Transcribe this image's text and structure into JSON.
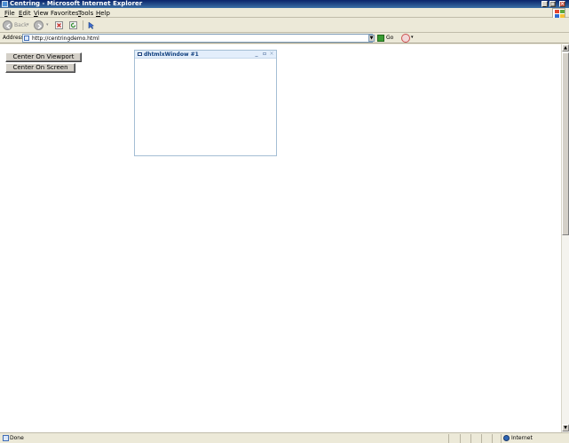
{
  "window": {
    "title": "Centring - Microsoft Internet Explorer"
  },
  "menu": {
    "items": [
      {
        "u": "F",
        "rest": "ile"
      },
      {
        "u": "E",
        "rest": "dit"
      },
      {
        "u": "V",
        "rest": "iew"
      },
      {
        "u": "",
        "rest": "Favorites",
        "label": "Favorites"
      },
      {
        "u": "T",
        "rest": "ools"
      },
      {
        "u": "H",
        "rest": "elp"
      }
    ]
  },
  "toolbar": {
    "back_label": "Back"
  },
  "address": {
    "label": "Address",
    "url": "http://centringdemo.html",
    "go_label": "Go"
  },
  "page": {
    "btn_viewport": "Center On Viewport",
    "btn_screen": "Center On Screen"
  },
  "dhx_window": {
    "title": "dhtmlxWindow #1"
  },
  "status": {
    "text": "Done",
    "zone": "Internet"
  }
}
